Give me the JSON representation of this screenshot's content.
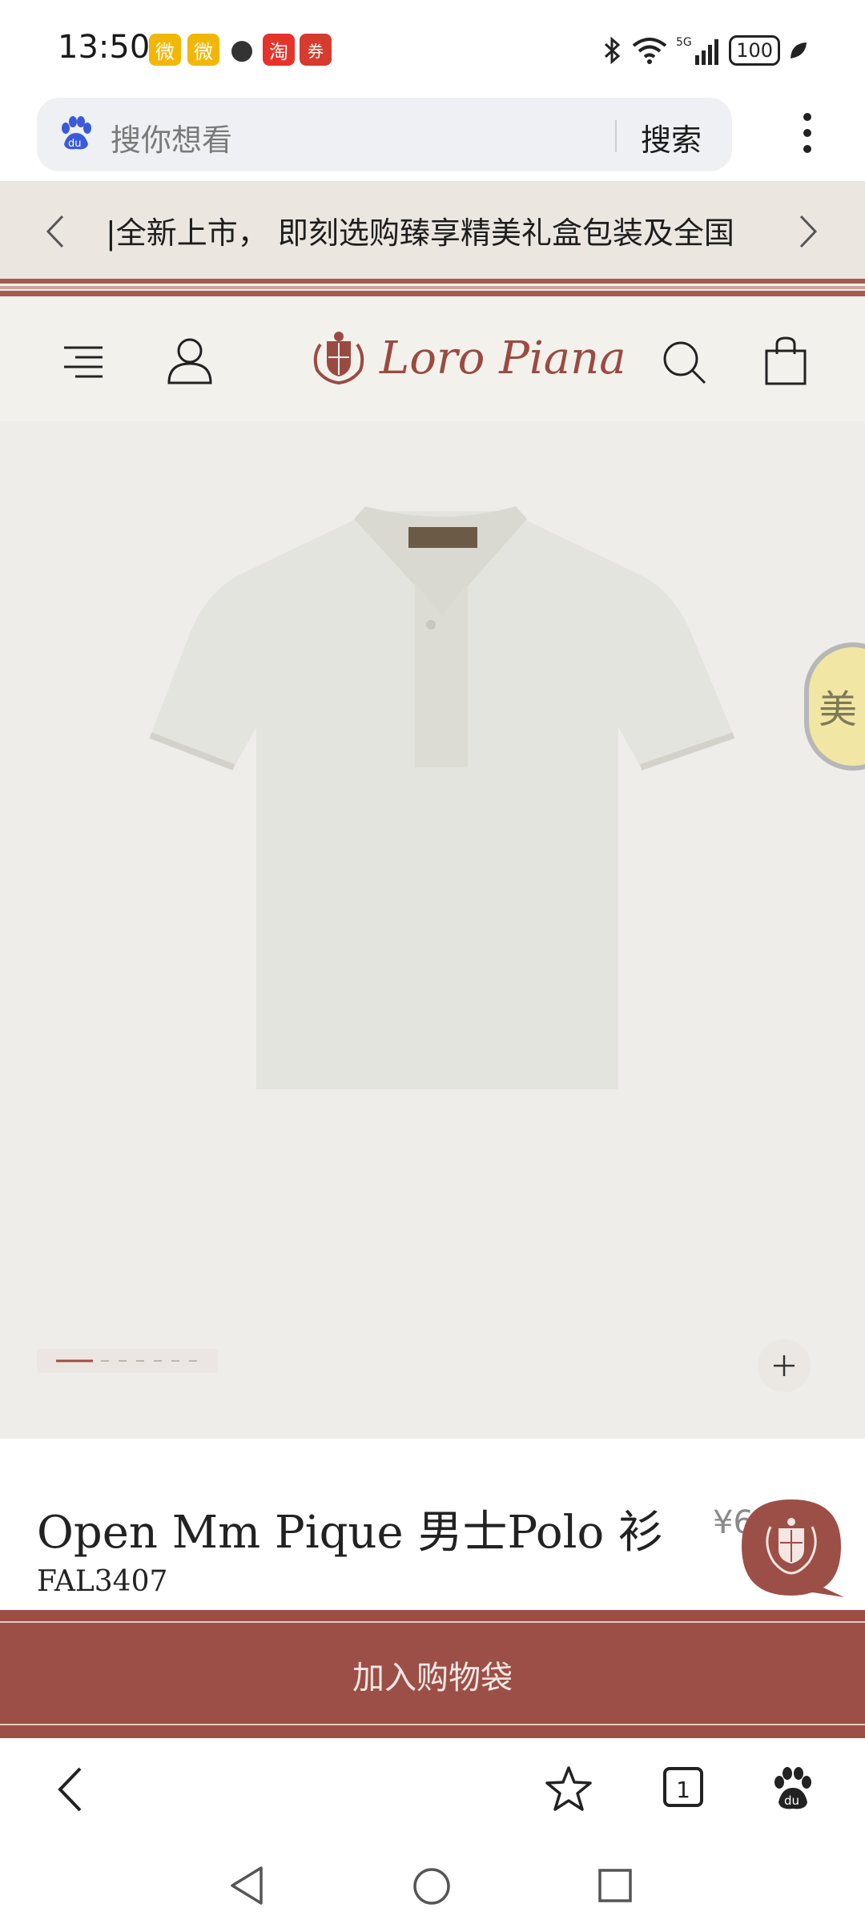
{
  "status_bar": {
    "time": "13:50",
    "apps": [
      {
        "icon": "weibo-icon",
        "color": "#e6162d",
        "glyph": "微"
      },
      {
        "icon": "weibo-icon",
        "color": "#e6162d",
        "glyph": "微"
      },
      {
        "icon": "wechat-icon",
        "color": "#333333",
        "glyph": "●"
      },
      {
        "icon": "taobao-icon",
        "color": "#ff4400",
        "glyph": "淘"
      },
      {
        "icon": "app-icon",
        "color": "#e84a3f",
        "glyph": "券"
      }
    ],
    "network": "5G",
    "battery": "100",
    "battery_level": 1.0
  },
  "search": {
    "placeholder": "搜你想看",
    "button_label": "搜索"
  },
  "promo": {
    "text": "|全新上市， 即刻选购臻享精美礼盒包装及全国"
  },
  "header": {
    "brand": "Loro Piana"
  },
  "gallery": {
    "image_count": 8,
    "active_index": 0
  },
  "floating": {
    "side_label": "美"
  },
  "product": {
    "title": "Open Mm Pique 男士Polo 衫",
    "price": "¥6",
    "code": "FAL3407"
  },
  "cta": {
    "add_to_bag": "加入购物袋"
  },
  "browser_toolbar": {
    "tab_count": "1"
  },
  "colors": {
    "brand_red": "#9c4f46",
    "background": "#f3f1ec",
    "shirt": "#e3e3dd"
  }
}
